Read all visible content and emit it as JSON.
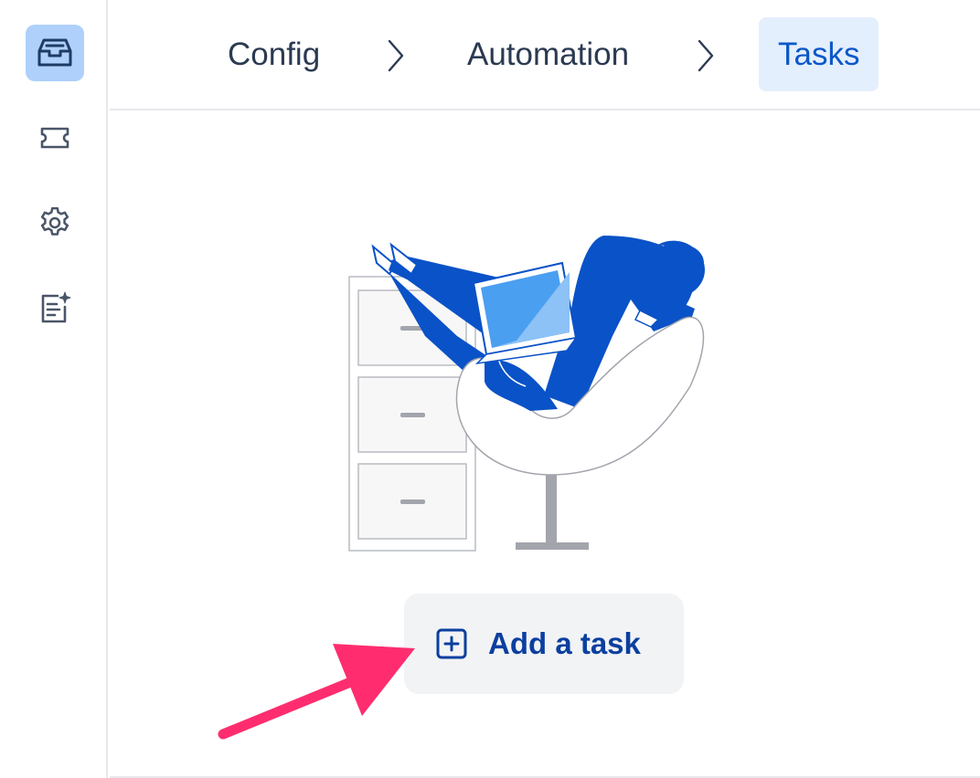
{
  "sidebar": {
    "items": [
      {
        "name": "inbox-icon",
        "active": true
      },
      {
        "name": "ticket-icon",
        "active": false
      },
      {
        "name": "gear-icon",
        "active": false
      },
      {
        "name": "document-sparkle-icon",
        "active": false
      }
    ]
  },
  "breadcrumb": {
    "items": [
      {
        "label": "Config"
      },
      {
        "label": "Automation"
      },
      {
        "label": "Tasks",
        "active": true
      }
    ],
    "separator_icon": "chevron-right-icon"
  },
  "empty_state": {
    "illustration": "person-relaxing-in-chair-with-laptop-illustration",
    "add_button": {
      "label": "Add a task",
      "icon": "plus-square-icon"
    }
  },
  "annotation": {
    "icon": "pointer-arrow-icon",
    "color": "#ff2d6f"
  },
  "colors": {
    "accent": "#0b57c9",
    "active_bg": "#e4effd",
    "sidebar_active_bg": "#aed0fb",
    "illustration_blue": "#0a52c7"
  }
}
